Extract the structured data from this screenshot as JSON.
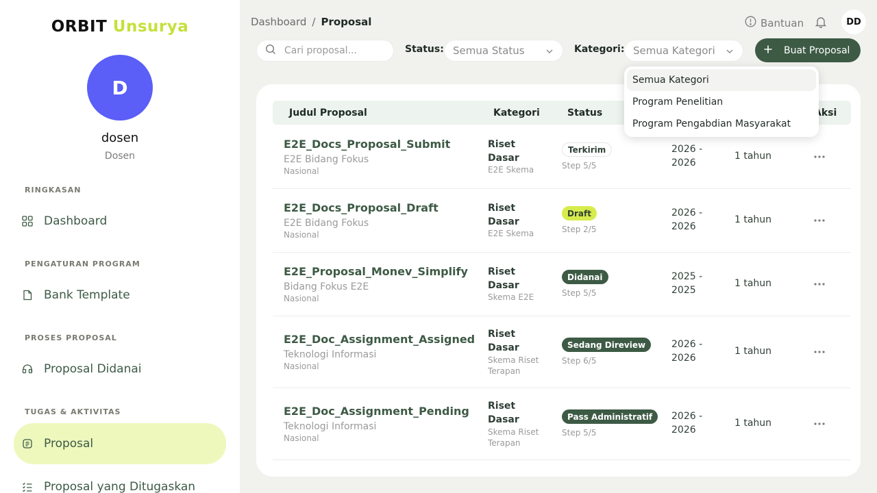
{
  "brand": {
    "part1": "ORBIT",
    "part2": "Unsurya"
  },
  "user": {
    "initial": "D",
    "name": "dosen",
    "role": "Dosen",
    "header_initials": "DD"
  },
  "sidebar": {
    "sections": [
      {
        "label": "RINGKASAN",
        "items": [
          {
            "label": "Dashboard",
            "icon": "grid-icon"
          }
        ]
      },
      {
        "label": "PENGATURAN PROGRAM",
        "items": [
          {
            "label": "Bank Template",
            "icon": "document-icon"
          }
        ]
      },
      {
        "label": "PROSES PROPOSAL",
        "items": [
          {
            "label": "Proposal Didanai",
            "icon": "funded-icon"
          }
        ]
      },
      {
        "label": "TUGAS & AKTIVITAS",
        "items": [
          {
            "label": "Proposal",
            "icon": "proposal-icon",
            "active": true
          },
          {
            "label": "Proposal yang Ditugaskan",
            "icon": "list-icon"
          }
        ]
      }
    ]
  },
  "header": {
    "breadcrumb": {
      "root": "Dashboard",
      "separator": "/",
      "current": "Proposal"
    },
    "help_label": "Bantuan"
  },
  "toolbar": {
    "search_placeholder": "Cari proposal...",
    "status_label": "Status:",
    "status_value": "Semua Status",
    "kategori_label": "Kategori:",
    "kategori_value": "Semua Kategori",
    "create_label": "Buat Proposal"
  },
  "table": {
    "columns": {
      "judul": "Judul Proposal",
      "kategori": "Kategori",
      "status": "Status",
      "aksi": "Aksi"
    },
    "rows": [
      {
        "title": "E2E_Docs_Proposal_Submit",
        "bidang": "E2E Bidang Fokus",
        "level": "Nasional",
        "kategori": "Riset Dasar",
        "skema": "E2E Skema",
        "status": "Terkirim",
        "status_style": "terkirim",
        "step": "Step 5/5",
        "period": "2026 - 2026",
        "duration": "1 tahun"
      },
      {
        "title": "E2E_Docs_Proposal_Draft",
        "bidang": "E2E Bidang Fokus",
        "level": "Nasional",
        "kategori": "Riset Dasar",
        "skema": "E2E Skema",
        "status": "Draft",
        "status_style": "draft",
        "step": "Step 2/5",
        "period": "2026 - 2026",
        "duration": "1 tahun"
      },
      {
        "title": "E2E_Proposal_Monev_Simplify",
        "bidang": "Bidang Fokus E2E",
        "level": "Nasional",
        "kategori": "Riset Dasar",
        "skema": "Skema E2E",
        "status": "Didanai",
        "status_style": "dark",
        "step": "Step 5/5",
        "period": "2025 - 2025",
        "duration": "1 tahun"
      },
      {
        "title": "E2E_Doc_Assignment_Assigned",
        "bidang": "Teknologi Informasi",
        "level": "Nasional",
        "kategori": "Riset Dasar",
        "skema": "Skema Riset Terapan",
        "status": "Sedang Direview",
        "status_style": "dark",
        "step": "Step 6/5",
        "period": "2026 - 2026",
        "duration": "1 tahun"
      },
      {
        "title": "E2E_Doc_Assignment_Pending",
        "bidang": "Teknologi Informasi",
        "level": "Nasional",
        "kategori": "Riset Dasar",
        "skema": "Skema Riset Terapan",
        "status": "Pass Administratif",
        "status_style": "dark",
        "step": "Step 5/5",
        "period": "2026 - 2026",
        "duration": "1 tahun"
      }
    ]
  },
  "kategori_dropdown": {
    "options": [
      "Semua Kategori",
      "Program Penelitian",
      "Program Pengabdian Masyarakat"
    ],
    "selected": "Semua Kategori"
  },
  "colors": {
    "accent": "#3d5a45",
    "brand_lime": "#c6e03c",
    "avatar": "#5b5ef7"
  }
}
